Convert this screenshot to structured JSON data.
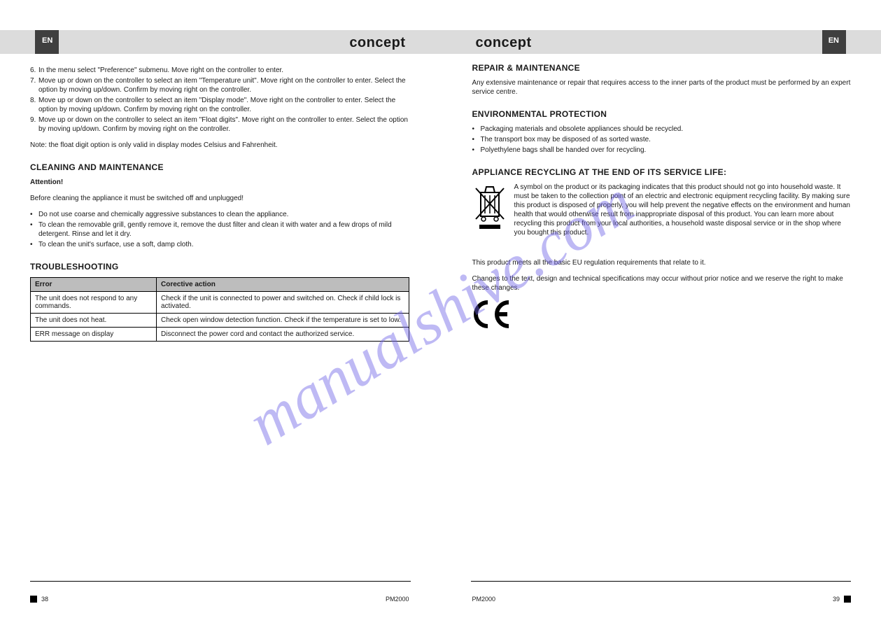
{
  "brand": "concept",
  "watermark": "manualshive.com",
  "left": {
    "lang": "EN",
    "model": "PM2000",
    "page": "38",
    "main_list": [
      "In the menu select \"Preference\" submenu. Move right on the controller to enter.",
      "Move up or down on the controller to select an item \"Temperature unit\". Move right on the controller to enter. Select the option by moving up/down. Confirm by moving right on the controller.",
      "Move up or down on the controller to select an item \"Display mode\". Move right on the controller to enter. Select the option by moving up/down. Confirm by moving right on the controller.",
      "Move up or down on the controller to select an item \"Float digits\". Move right on the controller to enter. Select the option by moving up/down. Confirm by moving right on the controller."
    ],
    "note": "Note: the float digit option is only valid in display modes Celsius and Fahrenheit.",
    "h_maint": "CLEANING AND MAINTENANCE",
    "h_maint_sub": "Attention!",
    "maint_p1": "Before cleaning the appliance it must be switched off and unplugged!",
    "maint_list": [
      "Do not use coarse and chemically aggressive substances to clean the appliance.",
      "To clean the removable grill, gently remove it, remove the dust filter and clean it with water and a few drops of mild detergent. Rinse and let it dry.",
      "To clean the unit's surface, use a soft, damp cloth."
    ],
    "h_trouble": "TROUBLESHOOTING",
    "table": {
      "head": [
        "Error",
        "Corective action"
      ],
      "rows": [
        [
          "The unit does not respond to any commands.",
          "Check if the unit is connected to power and switched on. Check if child lock is activated."
        ],
        [
          "The unit does not heat.",
          "Check open window detection function. Check if the temperature is set to low."
        ],
        [
          "ERR message on display",
          "Disconnect the power cord and contact the authorized service."
        ]
      ]
    }
  },
  "right": {
    "lang": "EN",
    "model": "PM2000",
    "page": "39",
    "h_repair": "REPAIR & MAINTENANCE",
    "repair_p": "Any extensive maintenance or repair that requires access to the inner parts of the product must be performed by an expert service centre.",
    "h_env": "ENVIRONMENTAL PROTECTION",
    "env_list": [
      "Packaging materials and obsolete appliances should be recycled.",
      "The transport box may be disposed of as sorted waste.",
      "Polyethylene bags shall be handed over for recycling."
    ],
    "h_recycle": "APPLIANCE RECYCLING AT THE END OF ITS SERVICE LIFE:",
    "recycle_p": "A symbol on the product or its packaging indicates that this product should not go into household waste. It must be taken to the collection point of an electric and electronic equipment recycling facility. By making sure this product is disposed of properly, you will help prevent the negative effects on the environment and human health that would otherwise result from inappropriate disposal of this product. You can learn more about recycling this product from your local authorities, a household waste disposal service or in the shop where you bought this product.",
    "compliance_p": "This product meets all the basic EU regulation requirements that relate to it.",
    "changes_p": "Changes to the text, design and technical specifications may occur without prior notice and we reserve the right to make these changes.",
    "ce_label": "CE"
  }
}
